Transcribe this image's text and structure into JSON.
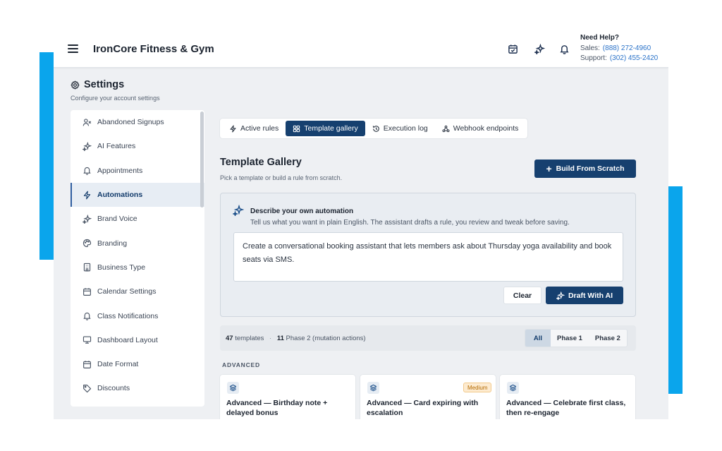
{
  "header": {
    "app_title": "IronCore Fitness & Gym",
    "icons": [
      "calendar-check-icon",
      "sparkles-icon",
      "bell-icon"
    ],
    "help": {
      "title": "Need Help?",
      "sales_label": "Sales:",
      "sales_phone": "(888) 272-4960",
      "support_label": "Support:",
      "support_phone": "(302) 455-2420"
    }
  },
  "settings": {
    "title": "Settings",
    "subtitle": "Configure your account settings"
  },
  "sidebar": {
    "items": [
      {
        "label": "Abandoned Signups",
        "icon": "user-x-icon"
      },
      {
        "label": "AI Features",
        "icon": "sparkles-icon"
      },
      {
        "label": "Appointments",
        "icon": "bell-icon"
      },
      {
        "label": "Automations",
        "icon": "bolt-icon",
        "active": true
      },
      {
        "label": "Brand Voice",
        "icon": "sparkles-icon"
      },
      {
        "label": "Branding",
        "icon": "palette-icon"
      },
      {
        "label": "Business Type",
        "icon": "building-icon"
      },
      {
        "label": "Calendar Settings",
        "icon": "calendar-icon"
      },
      {
        "label": "Class Notifications",
        "icon": "bell-icon"
      },
      {
        "label": "Dashboard Layout",
        "icon": "monitor-icon"
      },
      {
        "label": "Date Format",
        "icon": "calendar-icon"
      },
      {
        "label": "Discounts",
        "icon": "tag-icon"
      }
    ]
  },
  "tabs": [
    {
      "label": "Active rules",
      "icon": "bolt-icon"
    },
    {
      "label": "Template gallery",
      "icon": "grid-icon",
      "active": true
    },
    {
      "label": "Execution log",
      "icon": "history-icon"
    },
    {
      "label": "Webhook endpoints",
      "icon": "webhook-icon"
    }
  ],
  "gallery": {
    "title": "Template Gallery",
    "subtitle": "Pick a template or build a rule from scratch.",
    "build_button": "Build From Scratch"
  },
  "describe": {
    "title": "Describe your own automation",
    "subtitle": "Tell us what you want in plain English. The assistant drafts a rule, you review and tweak before saving.",
    "input_value": "Create a conversational booking assistant that lets members ask about Thursday yoga availability and book seats via SMS.",
    "clear_button": "Clear",
    "draft_button": "Draft With AI"
  },
  "filter": {
    "template_count": "47",
    "templates_label": "templates",
    "separator": "·",
    "phase2_count": "11",
    "phase2_label": "Phase 2 (mutation actions)",
    "segments": [
      "All",
      "Phase 1",
      "Phase 2"
    ],
    "selected": "All"
  },
  "section_label": "ADVANCED",
  "cards": [
    {
      "title": "Advanced — Birthday note + delayed bonus",
      "badge": ""
    },
    {
      "title": "Advanced — Card expiring with escalation",
      "badge": "Medium"
    },
    {
      "title": "Advanced — Celebrate first class, then re-engage",
      "badge": ""
    }
  ],
  "colors": {
    "accent": "#16406f",
    "decor_blue": "#0aa5ec",
    "link": "#2b73c9",
    "badge_medium": "#fdebd0"
  }
}
